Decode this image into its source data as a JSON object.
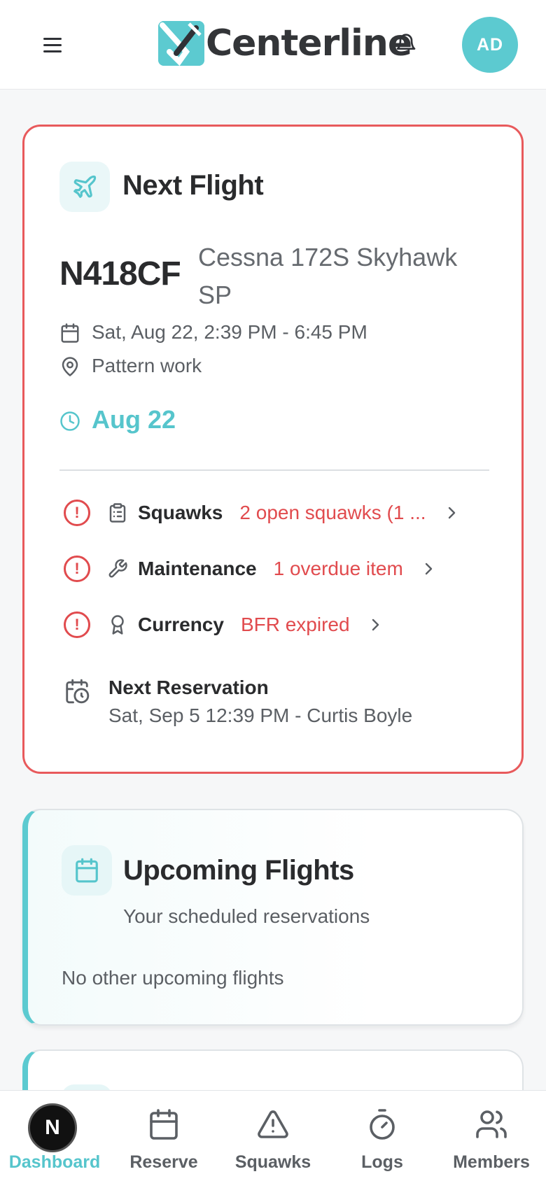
{
  "header": {
    "logo_text": "Centerline",
    "avatar_initials": "AD",
    "icons": {
      "menu": "hamburger-menu-icon",
      "notifications": "bell-icon"
    }
  },
  "next_flight": {
    "title": "Next Flight",
    "tail_number": "N418CF",
    "aircraft_model": "Cessna 172S Skyhawk SP",
    "time_range": "Sat, Aug 22, 2:39 PM - 6:45 PM",
    "purpose": "Pattern work",
    "date_short": "Aug 22",
    "status_items": [
      {
        "label": "Squawks",
        "value": "2 open squawks (1 ...",
        "state": "alert",
        "icon": "clipboard-icon"
      },
      {
        "label": "Maintenance",
        "value": "1 overdue item",
        "state": "alert",
        "icon": "wrench-icon"
      },
      {
        "label": "Currency",
        "value": "BFR expired",
        "state": "alert",
        "icon": "award-icon"
      }
    ],
    "next_reservation": {
      "label": "Next Reservation",
      "value": "Sat, Sep 5 12:39 PM - Curtis Boyle"
    },
    "colors": {
      "alert": "#e14b4e",
      "accent": "#56c5cc"
    }
  },
  "upcoming_flights": {
    "title": "Upcoming Flights",
    "subtitle": "Your scheduled reservations",
    "empty_text": "No other upcoming flights"
  },
  "bottom_nav": {
    "badge_letter": "N",
    "items": [
      {
        "label": "Dashboard",
        "active": true,
        "icon": "dashboard-icon"
      },
      {
        "label": "Reserve",
        "active": false,
        "icon": "calendar-icon"
      },
      {
        "label": "Squawks",
        "active": false,
        "icon": "warning-triangle-icon"
      },
      {
        "label": "Logs",
        "active": false,
        "icon": "stopwatch-icon"
      },
      {
        "label": "Members",
        "active": false,
        "icon": "users-icon"
      }
    ]
  }
}
